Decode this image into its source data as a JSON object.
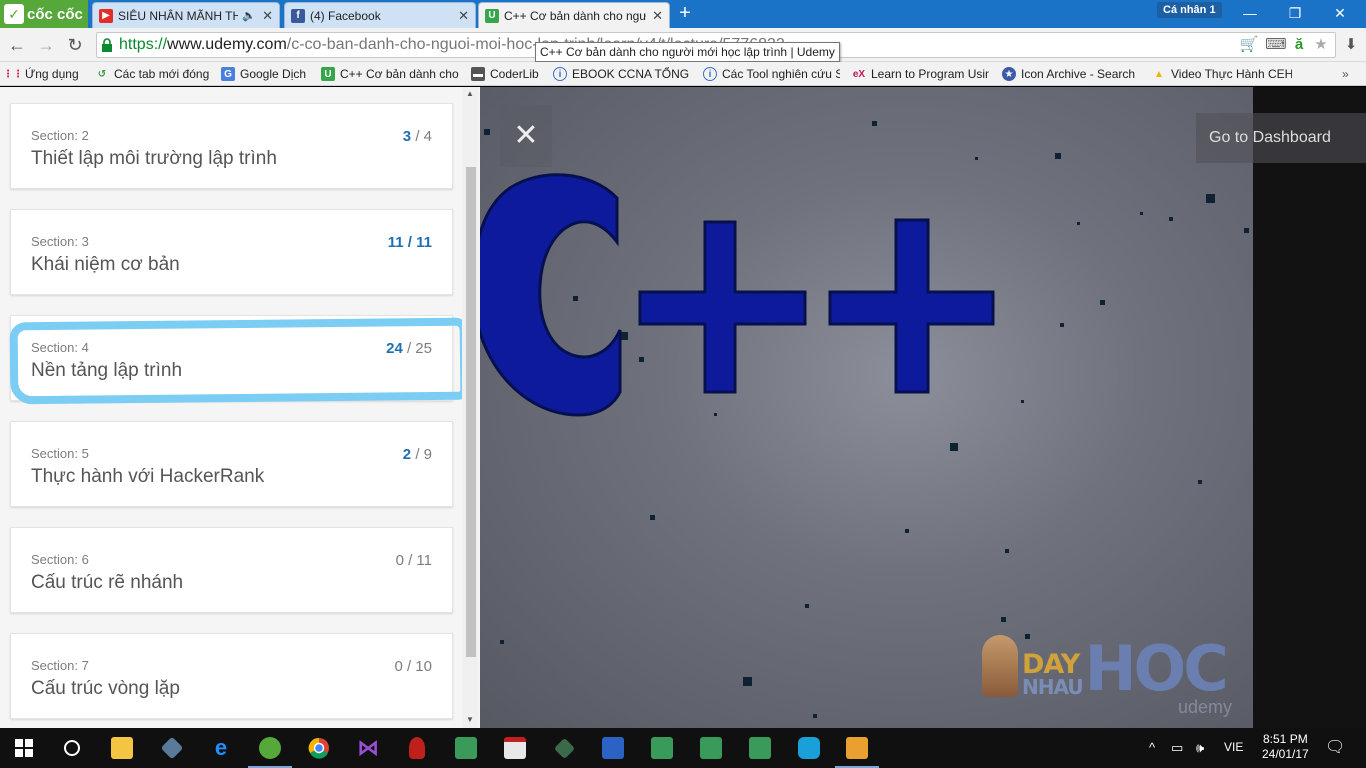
{
  "browser": {
    "brand": "cốc cốc",
    "tabs": [
      {
        "title": "SIÊU NHÂN MÃNH THÚ",
        "favicon": "youtube-icon",
        "color": "#e52d27"
      },
      {
        "title": "(4) Facebook",
        "favicon": "facebook-icon",
        "color": "#3b5998"
      },
      {
        "title": "C++ Cơ bản dành cho người",
        "favicon": "udemy-icon",
        "color": "#37a64a"
      }
    ],
    "profile": "Cá nhân 1",
    "url": {
      "scheme": "https://",
      "domain": "www.udemy.com",
      "path": "/c-co-ban-danh-cho-nguoi-moi-hoc-lap-trinh/learn/v4/t/lecture/5776832"
    },
    "tooltip": "C++ Cơ bản dành cho người mới học lập trình | Udemy"
  },
  "bookmarks": [
    {
      "label": "Ứng dụng",
      "icon": "apps-icon"
    },
    {
      "label": "Các tab mới đóng",
      "icon": "history-icon"
    },
    {
      "label": "Google Dịch",
      "icon": "translate-icon"
    },
    {
      "label": "C++ Cơ bản dành cho",
      "icon": "udemy-icon"
    },
    {
      "label": "CoderLib",
      "icon": "folder-icon"
    },
    {
      "label": "EBOOK CCNA TỔNG H",
      "icon": "info-icon"
    },
    {
      "label": "Các Tool nghiên cứu S",
      "icon": "info-icon"
    },
    {
      "label": "Learn to Program Usin",
      "icon": "edx-icon"
    },
    {
      "label": "Icon Archive - Search",
      "icon": "star-badge-icon"
    },
    {
      "label": "Video Thực Hành CEH",
      "icon": "drive-icon"
    }
  ],
  "sections": [
    {
      "label": "Section: 2",
      "title": "Thiết lập môi trường lập trình",
      "completed": "3",
      "total": "/ 4"
    },
    {
      "label": "Section: 3",
      "title": "Khái niệm cơ bản",
      "completed": "11",
      "total": "/ 11"
    },
    {
      "label": "Section: 4",
      "title": "Nền tảng lập trình",
      "completed": "24",
      "total": "/ 25"
    },
    {
      "label": "Section: 5",
      "title": "Thực hành với HackerRank",
      "completed": "2",
      "total": "/ 9"
    },
    {
      "label": "Section: 6",
      "title": "Cấu trúc rẽ nhánh",
      "completed": "0",
      "total": "/ 11"
    },
    {
      "label": "Section: 7",
      "title": "Cấu trúc vòng lặp",
      "completed": "0",
      "total": "/ 10"
    }
  ],
  "video": {
    "logo_text": "C++",
    "go_dashboard": "Go to Dashboard",
    "watermark": {
      "day": "DAY",
      "nhau": "NHAU",
      "hoc": "HOC",
      "udemy": "udemy"
    }
  },
  "taskbar": {
    "language": "VIE",
    "time": "8:51 PM",
    "date": "24/01/17"
  },
  "colors": {
    "accent": "#1f6fb2",
    "highlight": "#7ccdf3",
    "cpp_blue": "#0d1a9c"
  }
}
